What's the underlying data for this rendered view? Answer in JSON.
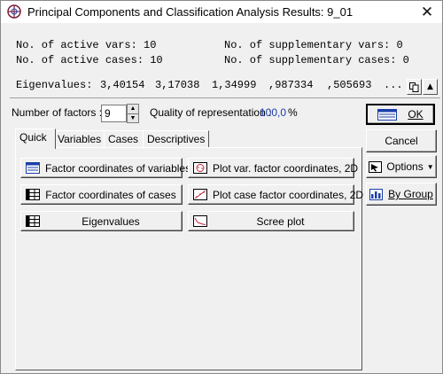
{
  "window": {
    "title": "Principal Components and Classification Analysis Results: 9_01",
    "close_glyph": "✕"
  },
  "info": {
    "active_vars_label": "No. of active vars:",
    "active_vars_value": "10",
    "supp_vars_label": "No. of supplementary vars:",
    "supp_vars_value": "0",
    "active_cases_label": "No. of active cases:",
    "active_cases_value": "10",
    "supp_cases_label": "No. of supplementary cases:",
    "supp_cases_value": "0",
    "eigen_label": "Eigenvalues:",
    "eigenvalues": [
      "3,40154",
      "3,17038",
      "1,34999",
      ",987334",
      ",505693",
      "..."
    ]
  },
  "factors": {
    "label": "Number of factors :",
    "value": "9",
    "quality_label": "Quality of representation :",
    "quality_value": "100,0",
    "quality_unit": "%"
  },
  "tabs": [
    "Quick",
    "Variables",
    "Cases",
    "Descriptives"
  ],
  "quick_buttons": {
    "factor_vars": "Factor coordinates of variables",
    "plot_var": "Plot var. factor coordinates, 2D",
    "factor_cases": "Factor coordinates of cases",
    "plot_case": "Plot case factor coordinates, 2D",
    "eigenvalues": "Eigenvalues",
    "scree": "Scree plot"
  },
  "side": {
    "ok": "OK",
    "cancel": "Cancel",
    "options": "Options",
    "by_group": "By Group"
  },
  "colors": {
    "accent_blue": "#1a3fa8",
    "title_bg": "#ffffff",
    "dialog_bg": "#f0f0f0"
  }
}
